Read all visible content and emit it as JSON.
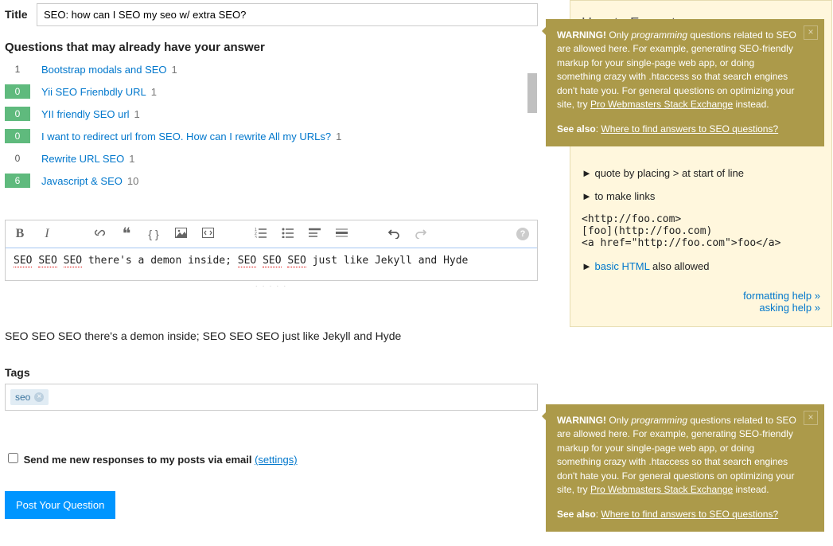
{
  "title": {
    "label": "Title",
    "value": "SEO: how can I SEO my seo w/ extra SEO?"
  },
  "dupes": {
    "header": "Questions that may already have your answer",
    "items": [
      {
        "votes": "6",
        "green": true,
        "title": "Javascript & SEO",
        "answers": "10"
      },
      {
        "votes": "0",
        "green": false,
        "title": "Rewrite URL SEO",
        "answers": "1"
      },
      {
        "votes": "0",
        "green": true,
        "title": "I want to redirect url from SEO. How can I rewrite All my URLs?",
        "answers": "1"
      },
      {
        "votes": "0",
        "green": true,
        "title": "YII friendly SEO url",
        "answers": "1"
      },
      {
        "votes": "0",
        "green": true,
        "title": "Yii SEO Frienbdly URL",
        "answers": "1"
      },
      {
        "votes": "1",
        "green": false,
        "title": "Bootstrap modals and SEO",
        "answers": "1"
      }
    ]
  },
  "editor": {
    "body_plain": "SEO SEO SEO there's a demon inside; SEO SEO SEO just like Jekyll and Hyde"
  },
  "preview": "SEO SEO SEO there's a demon inside; SEO SEO SEO just like Jekyll and Hyde",
  "tags": {
    "label": "Tags",
    "value": "seo"
  },
  "email": {
    "label": "Send me new responses to my posts via email",
    "settings": "(settings)"
  },
  "submit": "Post Your Question",
  "sidebar": {
    "title": "How to Format",
    "quote_line": "quote by placing > at start of line",
    "links_line": "to make links",
    "links_examples": "<http://foo.com>\n[foo](http://foo.com)\n<a href=\"http://foo.com\">foo</a>",
    "basic_html_prefix": "basic HTML",
    "basic_html_suffix": " also allowed",
    "help_links": {
      "formatting": "formatting help »",
      "asking": "asking help »"
    }
  },
  "popover": {
    "warning_word": "WARNING!",
    "text1": " Only ",
    "em": "programming",
    "text2": " questions related to SEO are allowed here. For example, generating SEO-friendly markup for your single-page web app, or doing something crazy with .htaccess so that search engines don't hate you. For general questions on optimizing your site, try ",
    "link1": "Pro Webmasters Stack Exchange",
    "text3": " instead.",
    "see_also_label": "See also",
    "see_also_link": "Where to find answers to SEO questions?"
  }
}
